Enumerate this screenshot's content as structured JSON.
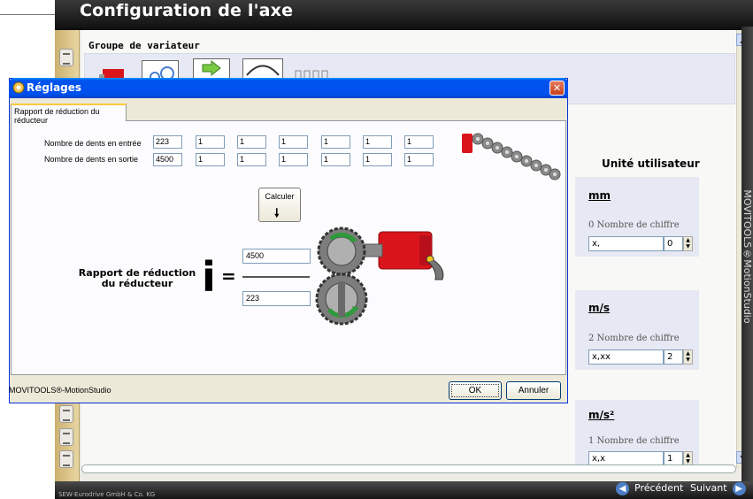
{
  "background": {
    "title": "Configuration de l'axe",
    "group_title": "Groupe de variateur",
    "vertical_text": "MOVITOOLS®MotionStudio",
    "copyright": "SEW-Eurodrive GmbH & Co. KG",
    "nav": {
      "prev": "Précédent",
      "next": "Suivant"
    },
    "unit_section_title": "Unité utilisateur",
    "units": [
      {
        "name": "mm",
        "digits_label": "0 Nombre de chiffre",
        "format": "x,",
        "digits": "0"
      },
      {
        "name": "m/s",
        "digits_label": "2 Nombre de chiffre",
        "format": "x,xx",
        "digits": "2"
      },
      {
        "name": "m/s²",
        "digits_label": "1 Nombre de chiffre",
        "format": "x,x",
        "digits": "1"
      }
    ]
  },
  "dialog": {
    "title": "Réglages",
    "tab_label": "Rapport de réduction du réducteur",
    "input_teeth_label": "Nombre de dents en entrée",
    "output_teeth_label": "Nombre de dents en sortie",
    "input_teeth": [
      "223",
      "1",
      "1",
      "1",
      "1",
      "1",
      "1"
    ],
    "output_teeth": [
      "4500",
      "1",
      "1",
      "1",
      "1",
      "1",
      "1"
    ],
    "calc_button": "Calculer",
    "ratio_label_line1": "Rapport de réduction",
    "ratio_label_line2": "du réducteur",
    "ratio_symbol": "i",
    "equals": "=",
    "numerator": "4500",
    "denominator": "223",
    "status": "MOVITOOLS®-MotionStudio",
    "ok": "OK",
    "cancel": "Annuler"
  },
  "colors": {
    "titlebar_blue": "#0053ee",
    "close_red": "#c7401d",
    "motor_red": "#d9151b",
    "gear_gray": "#7d7d7d",
    "gear_arrow_green": "#2e9a3a"
  }
}
